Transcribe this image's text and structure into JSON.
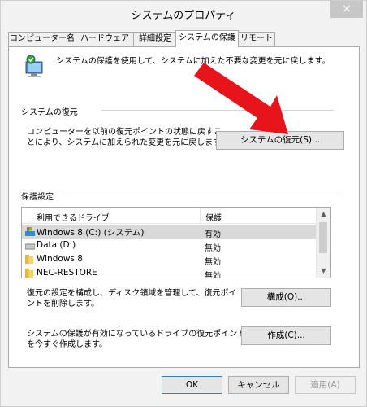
{
  "window": {
    "title": "システムのプロパティ",
    "close_glyph": "×"
  },
  "tabs": [
    {
      "label": "コンピューター名"
    },
    {
      "label": "ハードウェア"
    },
    {
      "label": "詳細設定"
    },
    {
      "label": "システムの保護",
      "active": true
    },
    {
      "label": "リモート"
    }
  ],
  "intro": {
    "text": "システムの保護を使用して、システムに加えた不要な変更を元に戻します。",
    "icon": "system-protection-computer-icon"
  },
  "restore": {
    "group_label": "システムの復元",
    "description_line1": "コンピューターを以前の復元ポイントの状態に戻すこ",
    "description_line2": "とにより、システムに加えられた変更を元に戻します。",
    "button": "システムの復元(S)..."
  },
  "protection": {
    "group_label": "保護設定",
    "columns": [
      "利用できるドライブ",
      "保護"
    ],
    "drives": [
      {
        "name": "Windows 8 (C:) (システム)",
        "status": "有効",
        "icon": "system-drive-icon",
        "selected": true
      },
      {
        "name": "Data (D:)",
        "status": "無効",
        "icon": "hard-drive-icon"
      },
      {
        "name": "Windows 8",
        "status": "無効",
        "icon": "folder-drive-icon"
      },
      {
        "name": "NEC-RESTORE",
        "status": "無効",
        "icon": "folder-drive-icon"
      }
    ],
    "configure_text_line1": "復元の設定を構成し、ディスク領域を管理して、復元ポイ",
    "configure_text_line2": "ントを削除します。",
    "configure_button": "構成(O)...",
    "create_text_line1": "システムの保護が有効になっているドライブの復元ポイント",
    "create_text_line2": "を今すぐ作成します。",
    "create_button": "作成(C)..."
  },
  "footer": {
    "ok": "OK",
    "cancel": "キャンセル",
    "apply": "適用(A)"
  },
  "colors": {
    "annotation_arrow": "#e8141b",
    "window_bg": "#f2f2f2"
  }
}
